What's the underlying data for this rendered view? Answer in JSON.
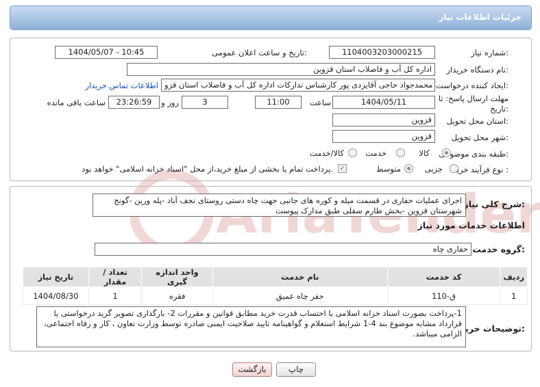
{
  "header": {
    "title": "جزئیات اطلاعات نیاز"
  },
  "fields": {
    "need_number_label": "شماره نیاز:",
    "need_number": "1104003203000215",
    "announce_label": "تاریخ و ساعت اعلان عمومی:",
    "announce_value": "1404/05/07 - 10:45",
    "buyer_org_label": "نام دستگاه خریدار:",
    "buyer_org": "اداره کل آب و فاضلاب استان قزوین",
    "creator_label": "ایجاد کننده درخواست:",
    "creator": "محمدجواد حاجی آقایزدی پور کارشناس تدارکات اداره کل آب و فاضلاب استان قزو",
    "contact_link": "اطلاعات تماس خریدار",
    "deadline_label_1": "مهلت ارسال پاسخ: تا",
    "deadline_label_2": "تاریخ:",
    "deadline_date": "1404/05/11",
    "time_label": "ساعت",
    "deadline_time": "11:00",
    "days_value": "3",
    "days_label": "روز و",
    "remaining_time": "23:26:59",
    "remaining_label": "ساعت باقی مانده",
    "province_label": "استان محل تحویل:",
    "province": "قزوین",
    "city_label": "شهر محل تحویل:",
    "city": "قزوین",
    "category_label": "طبقه بندی موضوعی:",
    "category_options": [
      "کالا",
      "خدمت",
      "کالا/خدمت"
    ],
    "process_label": "نوع فرآیند خرید :",
    "process_options": [
      "جزیی",
      "متوسط"
    ],
    "payment_note": "پرداخت تمام یا بخشی از مبلغ خرید،از محل \"اسناد خزانه اسلامی\" خواهد بود."
  },
  "summary": {
    "label": "شرح کلی نیاز:",
    "text": "اجرای عملیات حفاری در قسمت میله و کوره های جانبی  جهت چاه دستی روستای نجف آباد -پله ورین -گونج شهرستان قزوین -بخش طارم سفلی طبق مدارک پیوست"
  },
  "services": {
    "heading": "اطلاعات خدمات مورد نیاز",
    "group_label": "گروه خدمت:",
    "group_value": "حفاری چاه",
    "columns": [
      "ردیف",
      "کد خدمت",
      "نام خدمت",
      "واحد اندازه گیری",
      "تعداد / مقدار",
      "تاریخ نیاز"
    ],
    "rows": [
      {
        "row": "1",
        "code": "ق-110",
        "name": "حفر چاه عمیق",
        "unit": "فقره",
        "qty": "1",
        "date": "1404/08/30"
      }
    ]
  },
  "buyer_notes": {
    "label": "توضیحات خریدار:",
    "text": "1-پرداخت بصورت اسناد خزانه اسلامی با احتساب قدرت خرید مطابق قوانین و مقررات 2- بارگذاری تصویر گرید درخواستی یا قرارداد مشابه موضوع بند 4-1 شرایط استعلام و گواهینامه تایید صلاحیت ایمنی صادره توسط وزارت تعاون ، کار و رفاه اجتماعی، الزامی میباشد."
  },
  "buttons": {
    "print": "چاپ",
    "back": "بازگشت"
  },
  "watermark": {
    "text": "AriaTender.neT"
  },
  "colors": {
    "header_bg": "#8fb2d9",
    "link": "#1a4fc0",
    "watermark": "#e8b4b4"
  }
}
